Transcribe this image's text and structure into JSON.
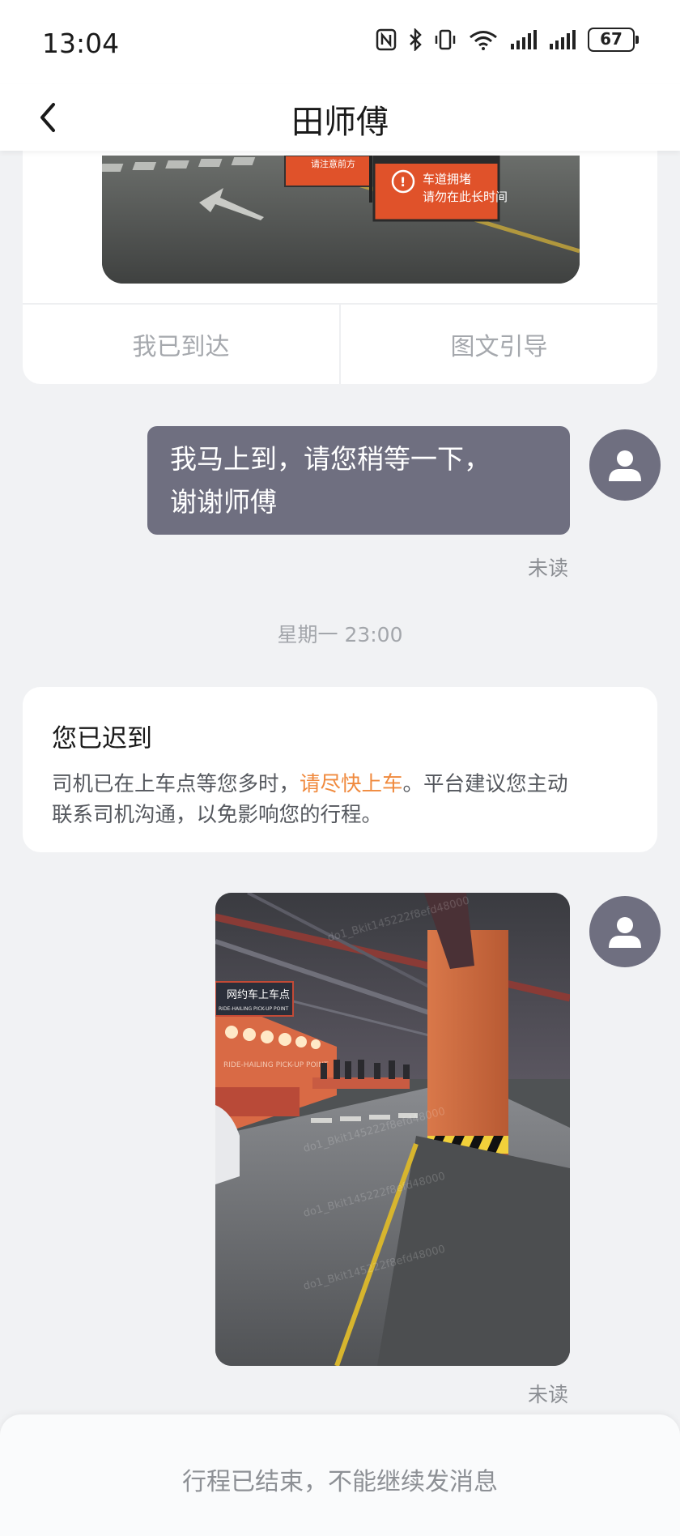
{
  "status_bar": {
    "time": "13:04",
    "battery": "67",
    "icons": [
      "nfc-icon",
      "bluetooth-icon",
      "vibrate-icon",
      "wifi-icon",
      "signal-icon",
      "signal-icon",
      "battery-icon"
    ]
  },
  "header": {
    "title": "田师傅",
    "back_icon": "chevron-left-icon"
  },
  "location_card": {
    "photo_signs": {
      "left_sign": "请注意前方",
      "right_sign": "车道拥堵",
      "right_sign_sub": "请勿在此长时间"
    },
    "actions": [
      "我已到达",
      "图文引导"
    ]
  },
  "messages": {
    "outgoing_text": "我马上到，请您稍等一下，谢谢师傅",
    "outgoing_text_line1": "我马上到，请您稍等一下，",
    "outgoing_text_line2": "谢谢师傅",
    "status_1": "未读",
    "timestamp": "星期一 23:00",
    "status_2": "未读"
  },
  "notice": {
    "title": "您已迟到",
    "text_before": "司机已在上车点等您多时，",
    "text_highlight": "请尽快上车",
    "text_after_line1": "。平台建议您主动",
    "text_line2": "联系司机沟通，以免影响您的行程。"
  },
  "sent_photo": {
    "sign": "网约车上车点",
    "sign_sub": "RIDE-HAILING PICK-UP POINT",
    "wall_text": "RIDE-HAILING PICK-UP POINT"
  },
  "footer": {
    "text": "行程已结束，不能继续发消息"
  },
  "colors": {
    "bubble": "#6f6f80",
    "highlight": "#f08a3e",
    "background": "#f1f2f4",
    "sign_orange": "#e0522a"
  }
}
